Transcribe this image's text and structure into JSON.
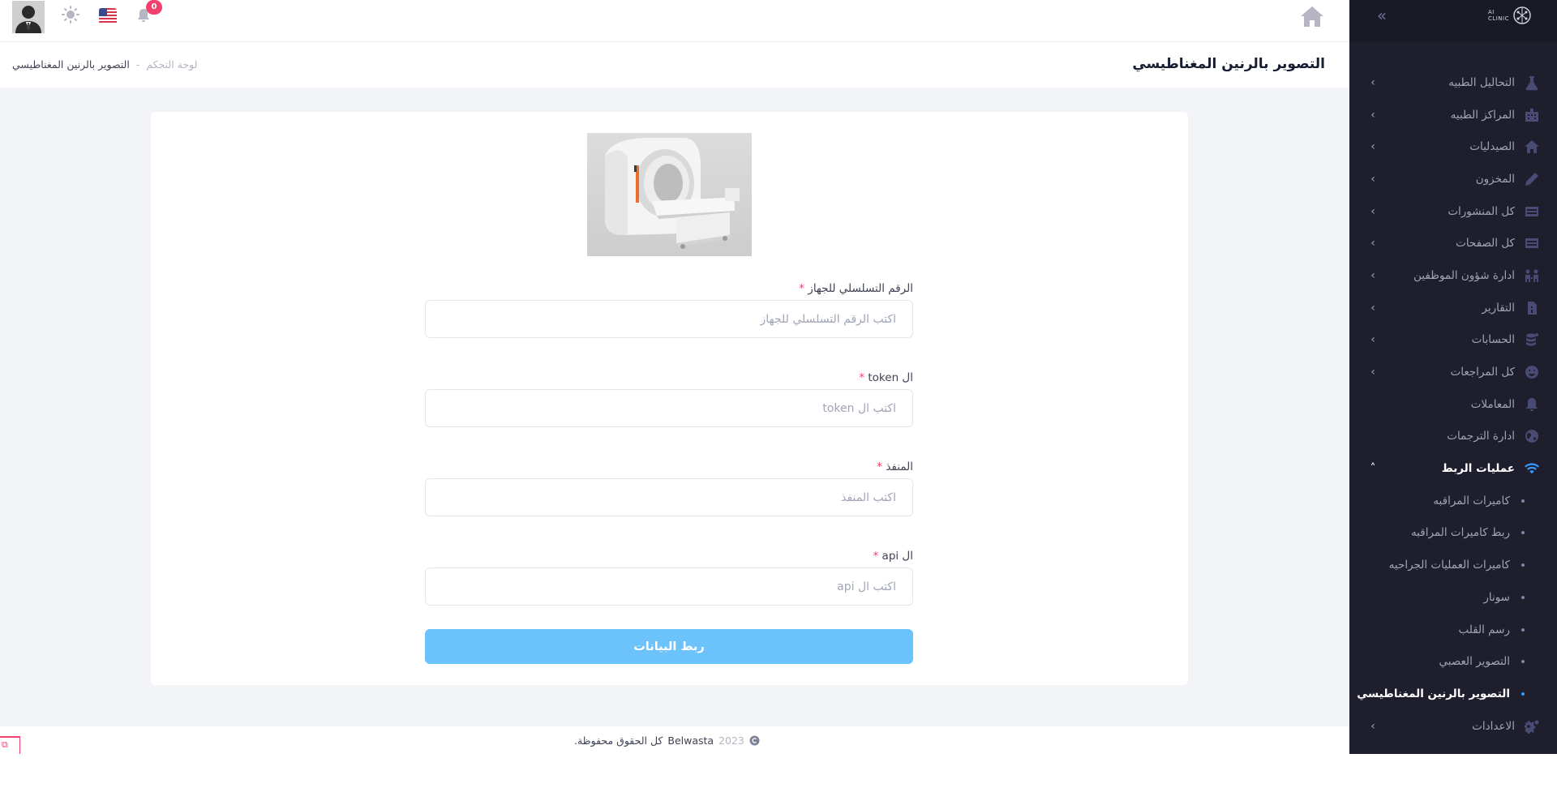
{
  "header": {
    "notification_count": "0"
  },
  "subheader": {
    "title": "التصوير بالرنين المغناطيسي",
    "breadcrumb": {
      "home": "لوحة التحكم",
      "separator": "-",
      "current": "التصوير بالرنين المغناطيسي"
    }
  },
  "sidebar": {
    "logo_text_line1": "AI",
    "logo_text_line2": "CLINIC",
    "items": [
      {
        "label": "التحاليل الطبيه",
        "icon": "lab-icon"
      },
      {
        "label": "المراكز الطبيه",
        "icon": "building-icon"
      },
      {
        "label": "الصيدليات",
        "icon": "home-icon"
      },
      {
        "label": "المخزون",
        "icon": "pen-icon"
      },
      {
        "label": "كل المنشورات",
        "icon": "table-icon"
      },
      {
        "label": "كل الصفحات",
        "icon": "table-icon"
      },
      {
        "label": "ادارة شؤون الموظفين",
        "icon": "users-icon"
      },
      {
        "label": "التقارير",
        "icon": "file-icon"
      },
      {
        "label": "الحسابات",
        "icon": "coins-icon"
      },
      {
        "label": "كل المراجعات",
        "icon": "smile-icon"
      },
      {
        "label": "المعاملات",
        "icon": "bell-icon"
      },
      {
        "label": "ادارة الترجمات",
        "icon": "globe-icon"
      }
    ],
    "active_group": {
      "label": "عمليات الربط",
      "icon": "wifi-icon",
      "children": [
        "كاميرات المراقبه",
        "ربط كاميرات المراقبه",
        "كاميرات العمليات الجراحيه",
        "سونار",
        "رسم القلب",
        "التصوير العصبي",
        "التصوير بالرنين المغناطيسي"
      ],
      "active_child": "التصوير بالرنين المغناطيسي"
    },
    "settings": {
      "label": "الاعدادات",
      "icon": "gears-icon"
    }
  },
  "form": {
    "fields": [
      {
        "label": "الرقم التسلسلي للجهاز",
        "required": "*",
        "placeholder": "اكتب الرقم التسلسلي للجهاز",
        "value": ""
      },
      {
        "label": "ال token",
        "required": "*",
        "placeholder": "اكتب ال token",
        "value": ""
      },
      {
        "label": "المنفذ",
        "required": "*",
        "placeholder": "اكتب المنفذ",
        "value": ""
      },
      {
        "label": "ال api",
        "required": "*",
        "placeholder": "اكتب ال api",
        "value": ""
      }
    ],
    "submit_label": "ربط البيانات"
  },
  "footer": {
    "year": "2023",
    "company": "Belwasta",
    "rights": "كل الحقوق محفوظة."
  },
  "colors": {
    "sidebar_bg": "#1e1e2d",
    "accent": "#3699ff",
    "submit_bg": "#6cc2fb",
    "badge": "#f1416c",
    "content_bg": "#f3f4f8"
  }
}
